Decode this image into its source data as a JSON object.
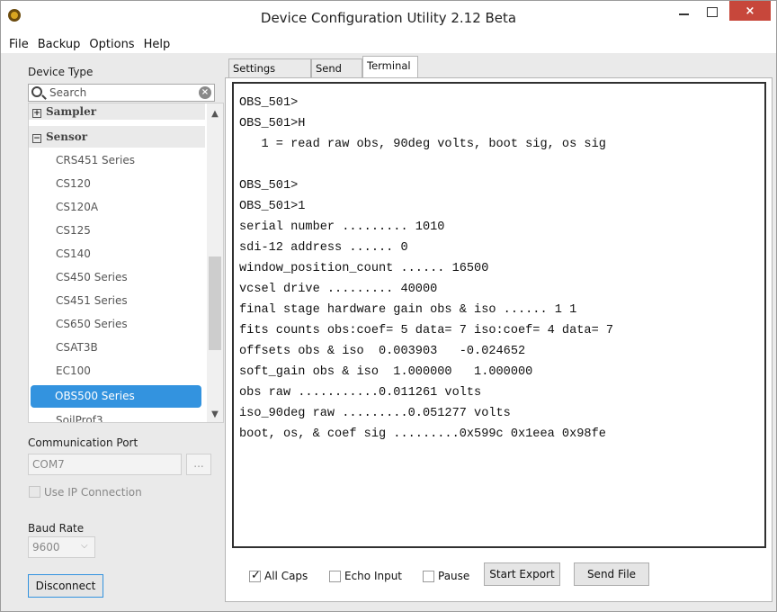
{
  "window": {
    "title": "Device Configuration Utility 2.12 Beta",
    "close_glyph": "×"
  },
  "menu": [
    "File",
    "Backup",
    "Options",
    "Help"
  ],
  "left": {
    "device_type_label": "Device Type",
    "search_placeholder": "Search",
    "groups": [
      {
        "label": "Sampler",
        "expander": "+"
      },
      {
        "label": "Sensor",
        "expander": "−"
      }
    ],
    "devices": [
      "CRS451 Series",
      "CS120",
      "CS120A",
      "CS125",
      "CS140",
      "CS450 Series",
      "CS451 Series",
      "CS650 Series",
      "CSAT3B",
      "EC100",
      "OBS500 Series",
      "SoilProf3"
    ],
    "selected_device": "OBS500 Series",
    "comm_port_label": "Communication Port",
    "comm_port_value": "COM7",
    "ellipsis": "...",
    "use_ip_label": "Use IP Connection",
    "baud_rate_label": "Baud Rate",
    "baud_rate_value": "9600",
    "disconnect_label": "Disconnect"
  },
  "tabs": [
    "Settings Editor",
    "Send OS",
    "Terminal"
  ],
  "active_tab": "Terminal",
  "terminal_lines": [
    "OBS_501>",
    "OBS_501>H",
    "   1 = read raw obs, 90deg volts, boot sig, os sig",
    "",
    "OBS_501>",
    "OBS_501>1",
    "serial number ......... 1010",
    "sdi-12 address ...... 0",
    "window_position_count ...... 16500",
    "vcsel drive ......... 40000",
    "final stage hardware gain obs & iso ...... 1 1",
    "fits counts obs:coef= 5 data= 7 iso:coef= 4 data= 7",
    "offsets obs & iso  0.003903   -0.024652",
    "soft_gain obs & iso  1.000000   1.000000",
    "obs raw ...........0.011261 volts",
    "iso_90deg raw .........0.051277 volts",
    "boot, os, & coef sig .........0x599c 0x1eea 0x98fe"
  ],
  "bottom": {
    "all_caps_label": "All Caps",
    "all_caps_checked": true,
    "echo_input_label": "Echo Input",
    "echo_input_checked": false,
    "pause_label": "Pause",
    "pause_checked": false,
    "start_export_label": "Start Export",
    "send_file_label": "Send File",
    "check_glyph": "✓"
  },
  "colors": {
    "selection": "#3393df",
    "close_button": "#c7473b"
  }
}
